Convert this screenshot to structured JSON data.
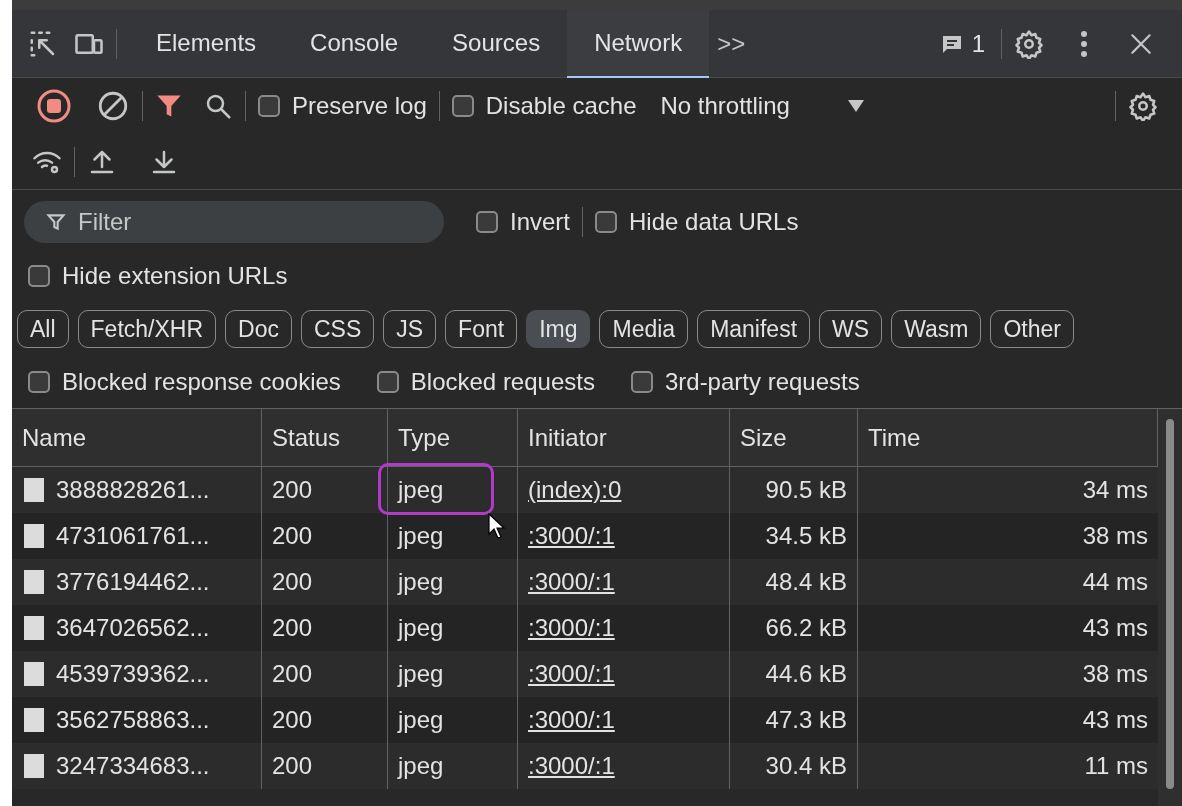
{
  "tabs": [
    {
      "label": "Elements",
      "selected": false
    },
    {
      "label": "Console",
      "selected": false
    },
    {
      "label": "Sources",
      "selected": false
    },
    {
      "label": "Network",
      "selected": true
    }
  ],
  "more_tabs": ">>",
  "issues_count": "1",
  "toolbar": {
    "recording": true,
    "filter_active": true,
    "preserve_log": {
      "label": "Preserve log",
      "checked": false
    },
    "disable_cache": {
      "label": "Disable cache",
      "checked": false
    },
    "throttling": "No throttling"
  },
  "filter": {
    "placeholder": "Filter",
    "invert": {
      "label": "Invert",
      "checked": false
    },
    "hide_data_urls": {
      "label": "Hide data URLs",
      "checked": false
    },
    "hide_extension_urls": {
      "label": "Hide extension URLs",
      "checked": false
    }
  },
  "type_filters": [
    {
      "label": "All",
      "selected": false
    },
    {
      "label": "Fetch/XHR",
      "selected": false
    },
    {
      "label": "Doc",
      "selected": false
    },
    {
      "label": "CSS",
      "selected": false
    },
    {
      "label": "JS",
      "selected": false
    },
    {
      "label": "Font",
      "selected": false
    },
    {
      "label": "Img",
      "selected": true
    },
    {
      "label": "Media",
      "selected": false
    },
    {
      "label": "Manifest",
      "selected": false
    },
    {
      "label": "WS",
      "selected": false
    },
    {
      "label": "Wasm",
      "selected": false
    },
    {
      "label": "Other",
      "selected": false
    }
  ],
  "extra_filters": [
    {
      "label": "Blocked response cookies",
      "checked": false
    },
    {
      "label": "Blocked requests",
      "checked": false
    },
    {
      "label": "3rd-party requests",
      "checked": false
    }
  ],
  "table": {
    "columns": [
      "Name",
      "Status",
      "Type",
      "Initiator",
      "Size",
      "Time"
    ],
    "rows": [
      {
        "name": "3888828261...",
        "status": "200",
        "type": "jpeg",
        "initiator": "(index):0",
        "size": "90.5 kB",
        "time": "34 ms",
        "highlighted": true
      },
      {
        "name": "4731061761...",
        "status": "200",
        "type": "jpeg",
        "initiator": ":3000/:1",
        "size": "34.5 kB",
        "time": "38 ms",
        "highlighted": false
      },
      {
        "name": "3776194462...",
        "status": "200",
        "type": "jpeg",
        "initiator": ":3000/:1",
        "size": "48.4 kB",
        "time": "44 ms",
        "highlighted": false
      },
      {
        "name": "3647026562...",
        "status": "200",
        "type": "jpeg",
        "initiator": ":3000/:1",
        "size": "66.2 kB",
        "time": "43 ms",
        "highlighted": false
      },
      {
        "name": "4539739362...",
        "status": "200",
        "type": "jpeg",
        "initiator": ":3000/:1",
        "size": "44.6 kB",
        "time": "38 ms",
        "highlighted": false
      },
      {
        "name": "3562758863...",
        "status": "200",
        "type": "jpeg",
        "initiator": ":3000/:1",
        "size": "47.3 kB",
        "time": "43 ms",
        "highlighted": false
      },
      {
        "name": "3247334683...",
        "status": "200",
        "type": "jpeg",
        "initiator": ":3000/:1",
        "size": "30.4 kB",
        "time": "11 ms",
        "highlighted": false
      }
    ]
  }
}
